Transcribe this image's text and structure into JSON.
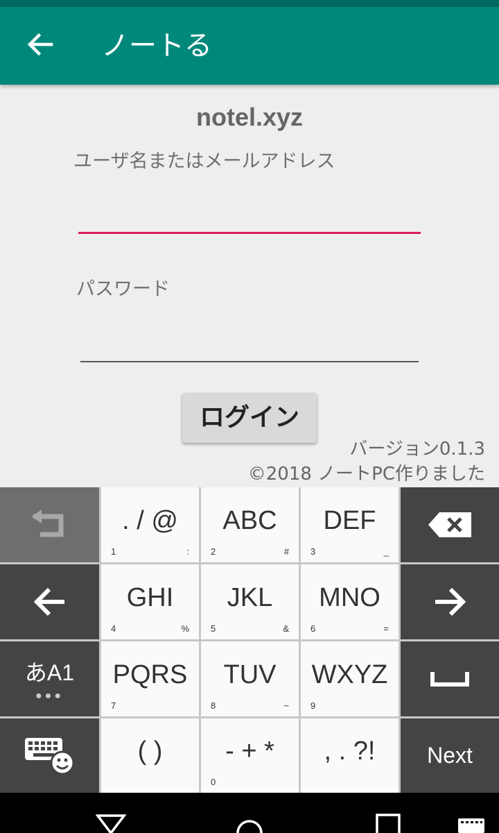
{
  "app": {
    "title": "ノートる"
  },
  "login": {
    "site_name": "notel.xyz",
    "username_label": "ユーザ名またはメールアドレス",
    "username_value": "",
    "password_label": "パスワード",
    "password_value": "",
    "login_button": "ログイン",
    "version": "バージョン0.1.3",
    "copyright": "©2018 ノートPC作りました"
  },
  "keyboard": {
    "rows": [
      [
        {
          "main": ". / @",
          "sub_left": "1",
          "sub_right": ":"
        },
        {
          "main": "ABC",
          "sub_left": "2",
          "sub_right": "#"
        },
        {
          "main": "DEF",
          "sub_left": "3",
          "sub_right": "_"
        }
      ],
      [
        {
          "main": "GHI",
          "sub_left": "4",
          "sub_right": "%"
        },
        {
          "main": "JKL",
          "sub_left": "5",
          "sub_right": "&"
        },
        {
          "main": "MNO",
          "sub_left": "6",
          "sub_right": "="
        }
      ],
      [
        {
          "main": "PQRS",
          "sub_left": "7",
          "sub_right": ""
        },
        {
          "main": "TUV",
          "sub_left": "8",
          "sub_right": "~"
        },
        {
          "main": "WXYZ",
          "sub_left": "9",
          "sub_right": ""
        }
      ],
      [
        {
          "main": "( )",
          "sub_left": "",
          "sub_right": ""
        },
        {
          "main": "- + *",
          "sub_left": "0",
          "sub_right": ""
        },
        {
          "main": ", . ?!",
          "sub_left": "",
          "sub_right": ""
        }
      ]
    ],
    "mode_key": "あA1",
    "next_key": "Next",
    "icons": [
      "undo-icon",
      "backspace-icon",
      "left-arrow-icon",
      "right-arrow-icon",
      "space-icon",
      "keyboard-settings-icon"
    ]
  },
  "colors": {
    "appbar": "#00897b",
    "statusbar": "#00695f",
    "accent": "#d81b60"
  }
}
